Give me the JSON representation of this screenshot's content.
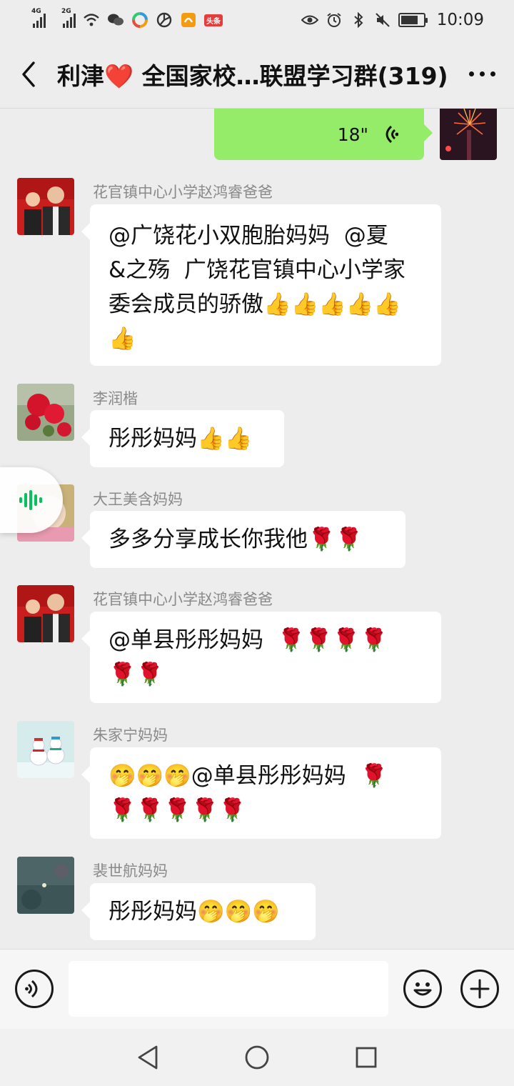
{
  "status_bar": {
    "net1": "4G",
    "net2": "2G",
    "toutiao": "头条",
    "time": "10:09",
    "battery_level": 0.75
  },
  "header": {
    "title": "利津❤️ 全国家校…联盟学习群(319)"
  },
  "voice_message": {
    "duration": "18\""
  },
  "messages": [
    {
      "sender": "花官镇中心小学赵鸿睿爸爸",
      "text": "@广饶花小双胞胎妈妈  @夏\n&之殇  广饶花官镇中心小学家\n委会成员的骄傲👍👍👍👍👍\n👍"
    },
    {
      "sender": "李润楷",
      "text": "彤彤妈妈👍👍"
    },
    {
      "sender": "大王美含妈妈",
      "text": "多多分享成长你我他🌹🌹"
    },
    {
      "sender": "花官镇中心小学赵鸿睿爸爸",
      "text": "@单县彤彤妈妈  🌹🌹🌹🌹\n🌹🌹"
    },
    {
      "sender": "朱家宁妈妈",
      "text": "🤭🤭🤭@单县彤彤妈妈  🌹\n🌹🌹🌹🌹🌹"
    },
    {
      "sender": "裴世航妈妈",
      "text": "彤彤妈妈🤭🤭🤭"
    }
  ],
  "input": {
    "value": ""
  },
  "icons": {
    "back": "back-arrow-icon",
    "more": "more-dots-icon",
    "voice_toggle": "voice-icon",
    "emoji": "emoji-icon",
    "plus": "plus-icon",
    "nav_back": "nav-back-icon",
    "nav_home": "nav-home-icon",
    "nav_recent": "nav-recent-icon"
  }
}
